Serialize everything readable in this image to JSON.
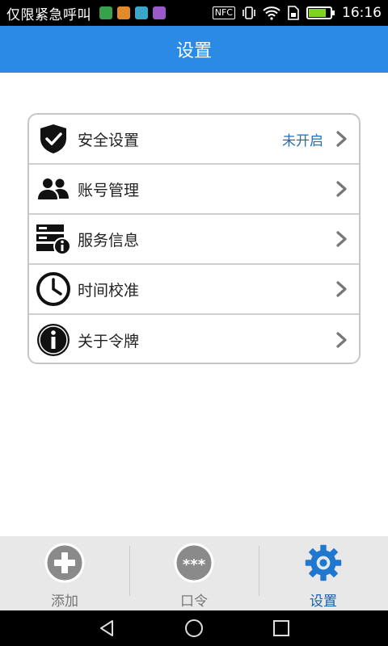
{
  "status_bar": {
    "carrier": "仅限紧急呼叫",
    "nfc": "NFC",
    "time": "16:16",
    "battery_level": 0.8
  },
  "title": "设置",
  "settings": {
    "items": [
      {
        "label": "安全设置",
        "value": "未开启",
        "icon": "shield-check-icon"
      },
      {
        "label": "账号管理",
        "value": "",
        "icon": "users-icon"
      },
      {
        "label": "服务信息",
        "value": "",
        "icon": "server-info-icon"
      },
      {
        "label": "时间校准",
        "value": "",
        "icon": "clock-icon"
      },
      {
        "label": "关于令牌",
        "value": "",
        "icon": "info-icon"
      }
    ]
  },
  "bottom_nav": {
    "items": [
      {
        "label": "添加",
        "icon": "plus-circle-icon",
        "active": false
      },
      {
        "label": "口令",
        "icon": "password-icon",
        "active": false,
        "icon_text": "***"
      },
      {
        "label": "设置",
        "icon": "gear-icon",
        "active": true
      }
    ]
  },
  "colors": {
    "title_bar": "#2a8ae6",
    "accent_value": "#1f6fb8",
    "active_tab": "#1a5fa8"
  }
}
